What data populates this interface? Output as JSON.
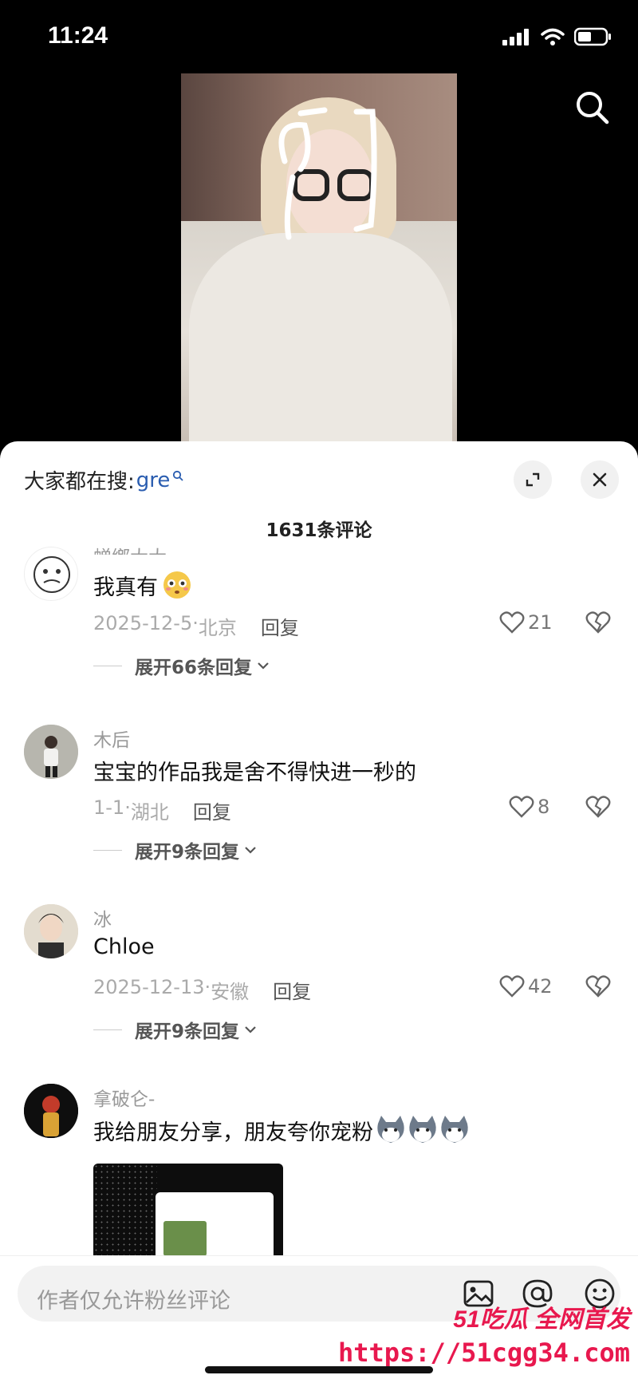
{
  "status": {
    "time": "11:24"
  },
  "sheet": {
    "hot_label": "大家都在搜:",
    "hot_term": "gre",
    "comment_count": "1631条评论"
  },
  "comments": [
    {
      "user": "蝉鄉大大",
      "text": "我真有",
      "emoji": "flushed-face",
      "date": "2025-12-5·",
      "location": "北京",
      "reply": "回复",
      "likes": "21",
      "expand": "展开66条回复"
    },
    {
      "user": "木后",
      "text": "宝宝的作品我是舍不得快进一秒的",
      "date": "1-1·",
      "location": "湖北",
      "reply": "回复",
      "likes": "8",
      "expand": "展开9条回复"
    },
    {
      "user": "冰",
      "text": "Chloe",
      "date": "2025-12-13·",
      "location": "安徽",
      "reply": "回复",
      "likes": "42",
      "expand": "展开9条回复"
    },
    {
      "user": "拿破仑-",
      "text": "我给朋友分享，朋友夸你宠粉",
      "emoji": "husky-face x3"
    }
  ],
  "input": {
    "placeholder": "作者仅允许粉丝评论"
  },
  "watermark": {
    "brand": "51吃瓜 全网首发",
    "url": "https://51cgg34.com"
  },
  "colors": {
    "accent": "#2a5db0",
    "watermark": "#e8184e"
  }
}
